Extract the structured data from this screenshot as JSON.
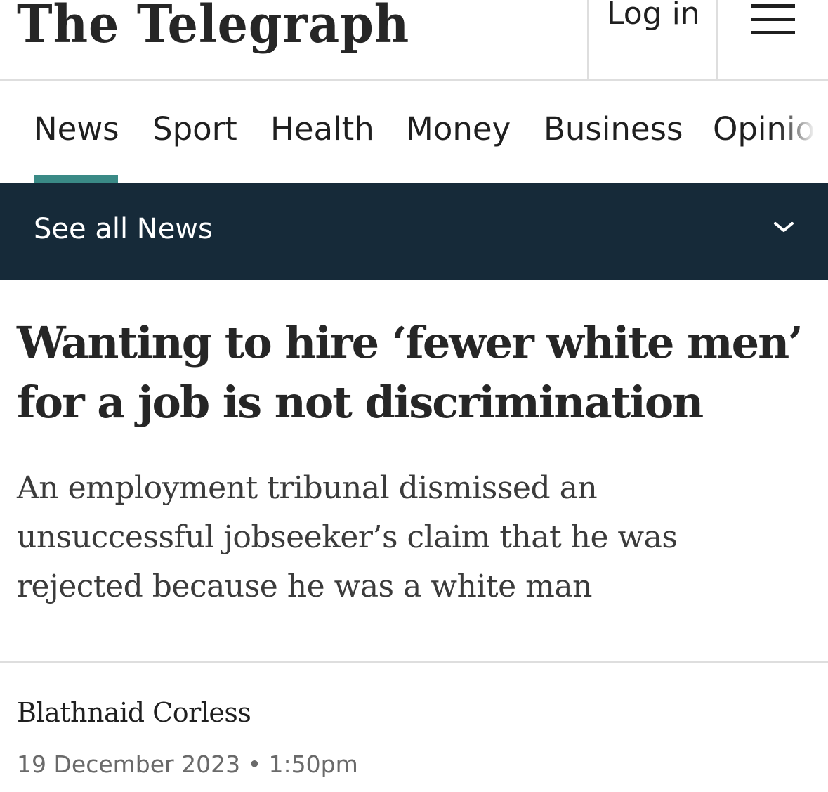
{
  "header": {
    "masthead": "The Telegraph",
    "login_label": "Log in"
  },
  "nav": {
    "items": [
      {
        "label": "News",
        "active": true
      },
      {
        "label": "Sport"
      },
      {
        "label": "Health"
      },
      {
        "label": "Money"
      },
      {
        "label": "Business"
      },
      {
        "label": "Opinion"
      }
    ],
    "active_color": "#3a8a86"
  },
  "subnav": {
    "label": "See all News",
    "background": "#162a39"
  },
  "article": {
    "headline": "Wanting to hire ‘fewer white men’ for a job is not discrimination",
    "standfirst": "An employment tribunal dismissed an unsuccessful jobseeker’s claim that he was rejected because he was a white man",
    "author": "Blathnaid Corless",
    "date": "19 December 2023",
    "time": "1:50pm"
  }
}
